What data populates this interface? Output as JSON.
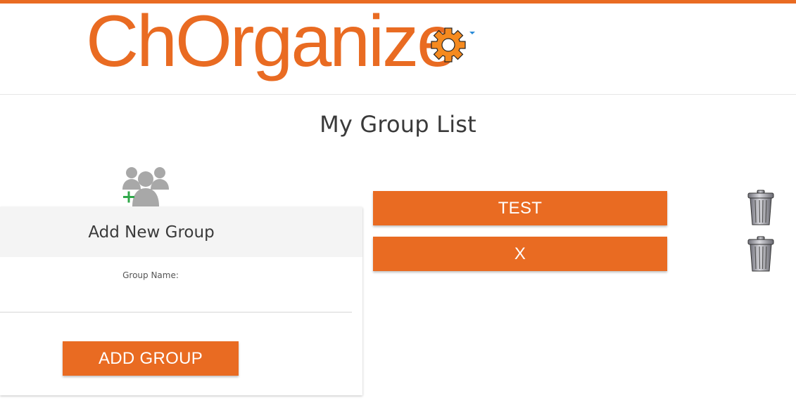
{
  "app": {
    "logo_text": "ChOrganize",
    "accent_color": "#e96b22",
    "settings_icon": "gear-icon"
  },
  "page": {
    "title": "My Group List"
  },
  "add_group_panel": {
    "icon": "add-group-icon",
    "title": "Add New Group",
    "field_label": "Group Name:",
    "field_value": "",
    "button_label": "ADD GROUP"
  },
  "groups": [
    {
      "name": "TEST",
      "delete_icon": "trash-icon"
    },
    {
      "name": "X",
      "delete_icon": "trash-icon"
    }
  ]
}
